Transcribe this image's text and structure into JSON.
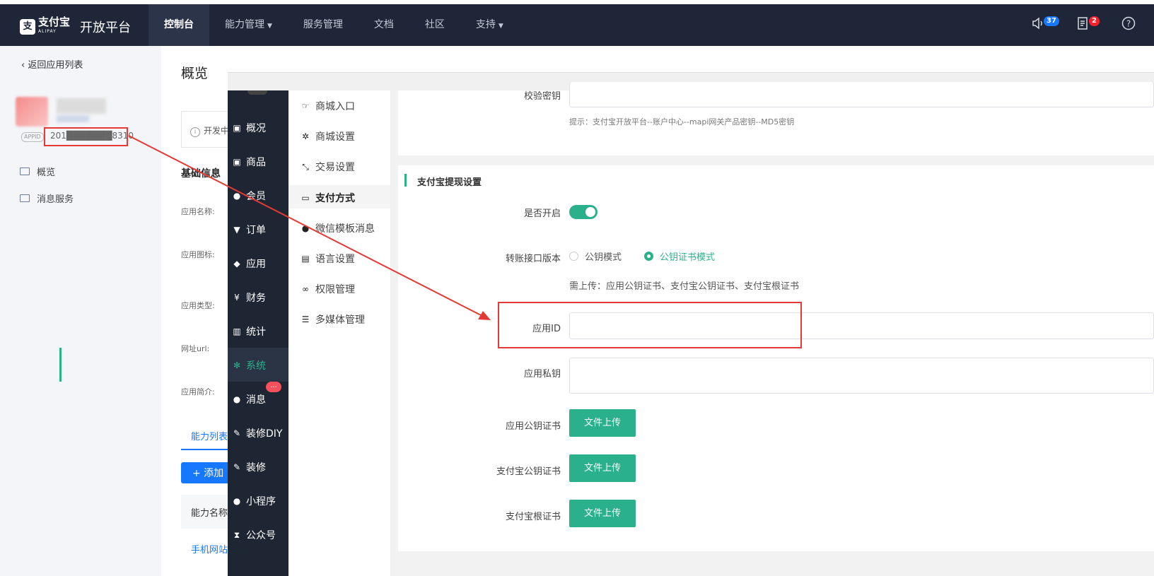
{
  "topbar": {
    "logo_mark": "支",
    "brand": "支付宝",
    "brand_en": "ALIPAY",
    "title": "开放平台",
    "nav": [
      {
        "label": "控制台",
        "active": true,
        "dropdown": false
      },
      {
        "label": "能力管理",
        "active": false,
        "dropdown": true
      },
      {
        "label": "服务管理",
        "active": false,
        "dropdown": false
      },
      {
        "label": "文档",
        "active": false,
        "dropdown": false
      },
      {
        "label": "社区",
        "active": false,
        "dropdown": false
      },
      {
        "label": "支持",
        "active": false,
        "dropdown": true
      }
    ],
    "speaker_badge": "37",
    "task_badge": "2",
    "help_glyph": "?"
  },
  "left": {
    "back_label": "返回应用列表",
    "appid_tag": "APPID",
    "appid_value": "201███████8310",
    "nav": [
      "概览",
      "消息服务"
    ]
  },
  "overview": {
    "title": "概览",
    "notice": "开发中",
    "section": "基础信息",
    "labels": [
      "应用名称:",
      "应用图标:",
      "应用类型:",
      "网址url:",
      "应用简介:"
    ],
    "tab": "能力列表",
    "add_button": "+ 添加",
    "table_header": "能力名称",
    "table_link": "手机网站"
  },
  "modal": {
    "side_nav": [
      {
        "label": "概况",
        "icon": "box-icon"
      },
      {
        "label": "商品",
        "icon": "box-icon"
      },
      {
        "label": "会员",
        "icon": "users-icon"
      },
      {
        "label": "订单",
        "icon": "cart-icon"
      },
      {
        "label": "应用",
        "icon": "cubes-icon"
      },
      {
        "label": "财务",
        "icon": "yen-icon"
      },
      {
        "label": "统计",
        "icon": "bar-chart-icon"
      },
      {
        "label": "系统",
        "icon": "gears-icon",
        "active": true
      },
      {
        "label": "消息",
        "icon": "chat-icon"
      },
      {
        "label": "装修DIY",
        "icon": "hammer-icon"
      },
      {
        "label": "装修",
        "icon": "hammer-icon"
      },
      {
        "label": "小程序",
        "icon": "wechat-icon"
      },
      {
        "label": "公众号",
        "icon": "hourglass-icon"
      }
    ],
    "message_badge": "...",
    "sub_nav": [
      {
        "label": "商城入口",
        "icon": "hand-point-icon"
      },
      {
        "label": "商城设置",
        "icon": "gear-icon"
      },
      {
        "label": "交易设置",
        "icon": "compress-icon"
      },
      {
        "label": "支付方式",
        "icon": "credit-card-icon",
        "active": true
      },
      {
        "label": "微信模板消息",
        "icon": "wechat-icon"
      },
      {
        "label": "语言设置",
        "icon": "language-icon"
      },
      {
        "label": "权限管理",
        "icon": "link-icon"
      },
      {
        "label": "多媒体管理",
        "icon": "list-icon"
      }
    ],
    "verify_key_label": "校验密钥",
    "verify_key_hint": "提示：支付宝开放平台--账户中心--mapi网关产品密钥--MD5密钥",
    "section_title": "支付宝提现设置",
    "enable_label": "是否开启",
    "enabled": true,
    "version_label": "转账接口版本",
    "version_options": [
      "公钥模式",
      "公钥证书模式"
    ],
    "version_selected": "公钥证书模式",
    "upload_hint": "需上传：应用公钥证书、支付宝公钥证书、支付宝根证书",
    "app_id_label": "应用ID",
    "app_id_value": "",
    "private_key_label": "应用私钥",
    "private_key_value": "",
    "cert_rows": [
      {
        "label": "应用公钥证书",
        "button": "文件上传"
      },
      {
        "label": "支付宝公钥证书",
        "button": "文件上传"
      },
      {
        "label": "支付宝根证书",
        "button": "文件上传"
      }
    ]
  },
  "colors": {
    "topbar": "#1e2638",
    "accent_green": "#2bb08c",
    "accent_blue": "#1677ff",
    "annotation_red": "#e53935"
  }
}
